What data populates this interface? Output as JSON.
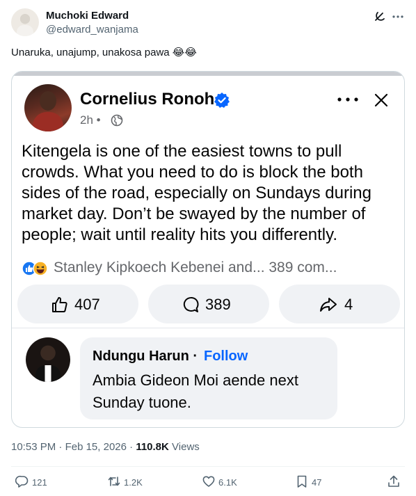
{
  "tweet": {
    "author_name": "Muchoki Edward",
    "author_handle": "@edward_wanjama",
    "text": "Unaruka, unajump, unakosa pawa 😂😂",
    "time": "10:53 PM",
    "date": "Feb 15, 2026",
    "views_count": "110.8K",
    "views_label": "Views",
    "replies": "121",
    "reposts": "1.2K",
    "likes": "6.1K",
    "bookmarks": "47"
  },
  "fb_post": {
    "author_name": "Cornelius Ronoh",
    "time": "2h",
    "body_lines": [
      "Kitengela is one of the easiest towns to pull",
      "crowds. What you need to do is block the both",
      "sides of the road, especially on Sundays during",
      "market day. Don’t be swayed by the number of",
      "people; wait until reality hits you differently."
    ],
    "reactions_text": "Stanley Kipkoech Kebenei and... 389 com...",
    "likes": "407",
    "comments": "389",
    "shares": "4"
  },
  "fb_comment": {
    "author": "Ndungu Harun",
    "follow_label": "Follow",
    "text_lines": [
      "Ambia Gideon Moi aende next",
      "Sunday tuone."
    ]
  },
  "colors": {
    "x_text": "#0f1419",
    "x_muted": "#536471",
    "fb_blue": "#0866ff",
    "fb_muted": "#65676b",
    "pill_bg": "#f0f2f5"
  },
  "icons": [
    "grok-icon",
    "more-icon",
    "verified-icon",
    "globe-icon",
    "close-icon",
    "thumbs-up-icon",
    "comment-icon",
    "share-icon",
    "reply-icon",
    "repost-icon",
    "heart-icon",
    "bookmark-icon",
    "upload-icon"
  ]
}
